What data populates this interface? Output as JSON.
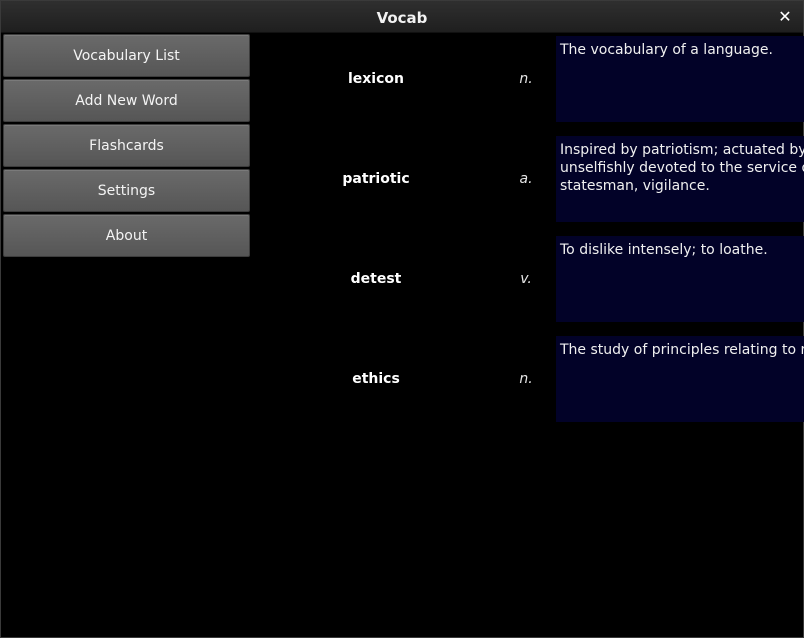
{
  "window": {
    "title": "Vocab",
    "close_glyph": "✕"
  },
  "sidebar": {
    "items": [
      {
        "label": "Vocabulary List"
      },
      {
        "label": "Add New Word"
      },
      {
        "label": "Flashcards"
      },
      {
        "label": "Settings"
      },
      {
        "label": "About"
      }
    ]
  },
  "words": [
    {
      "word": "lexicon",
      "pos": "n.",
      "definition_lines": [
        "The vocabulary of a language."
      ]
    },
    {
      "word": "patriotic",
      "pos": "a.",
      "definition_lines": [
        "Inspired by patriotism; actuated by lo",
        "unselfishly devoted to the service of",
        "statesman, vigilance."
      ]
    },
    {
      "word": "detest",
      "pos": "v.",
      "definition_lines": [
        "To dislike intensely; to loathe."
      ]
    },
    {
      "word": "ethics",
      "pos": "n.",
      "definition_lines": [
        "The study of principles relating to rig"
      ]
    }
  ],
  "colors": {
    "background": "#000000",
    "definition_bg": "#020228",
    "button_bg": "#5f5f5f"
  }
}
